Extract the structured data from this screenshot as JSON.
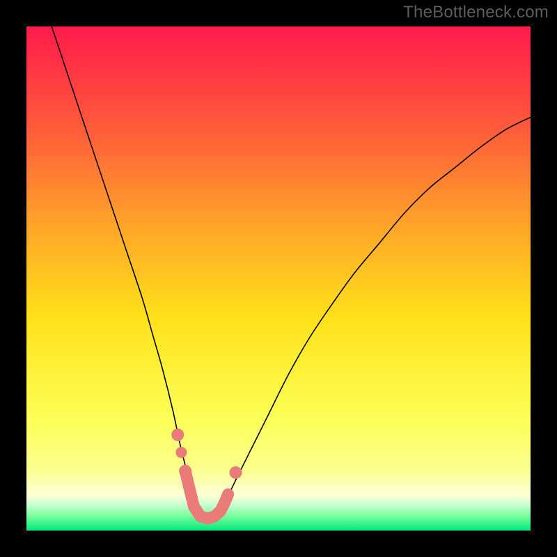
{
  "attribution": "TheBottleneck.com",
  "colors": {
    "background_black": "#000000",
    "gradient_top": "#ff1a4b",
    "gradient_mid_upper": "#ff7a2a",
    "gradient_mid": "#ffe21a",
    "gradient_lower_yellow": "#fbff8e",
    "gradient_pale": "#feffd7",
    "gradient_green_top": "#7cff9e",
    "gradient_green_bottom": "#00e97a",
    "curve": "#000000",
    "marker": "#eb7b78",
    "attribution_text": "#5d5d5d"
  },
  "chart_data": {
    "type": "line",
    "title": "",
    "xlabel": "",
    "ylabel": "",
    "xlim": [
      0,
      100
    ],
    "ylim": [
      0,
      100
    ],
    "grid": false,
    "series": [
      {
        "name": "bottleneck-curve",
        "x": [
          5,
          8,
          11,
          14,
          17,
          20,
          23,
          25,
          27,
          29,
          30.5,
          32,
          33,
          34,
          35,
          36,
          37,
          38,
          40,
          42,
          45,
          48,
          52,
          56,
          60,
          65,
          70,
          75,
          80,
          85,
          90,
          95,
          100
        ],
        "y": [
          100,
          91,
          82,
          73,
          64,
          55,
          46,
          39,
          32,
          24,
          17,
          11,
          7,
          4,
          2.5,
          2,
          2.5,
          4,
          7,
          11,
          17,
          23,
          31,
          38,
          44,
          51,
          57,
          63,
          68,
          72,
          76,
          79.5,
          82
        ]
      }
    ],
    "markers": {
      "name": "highlight-points",
      "x": [
        30.0,
        30.7,
        31.5,
        33.2,
        34.5,
        36.0,
        37.3,
        38.5,
        39.3,
        40.0,
        41.5
      ],
      "y": [
        19.0,
        15.5,
        11.8,
        4.8,
        2.8,
        2.4,
        2.8,
        3.9,
        5.5,
        7.2,
        11.5
      ]
    }
  }
}
